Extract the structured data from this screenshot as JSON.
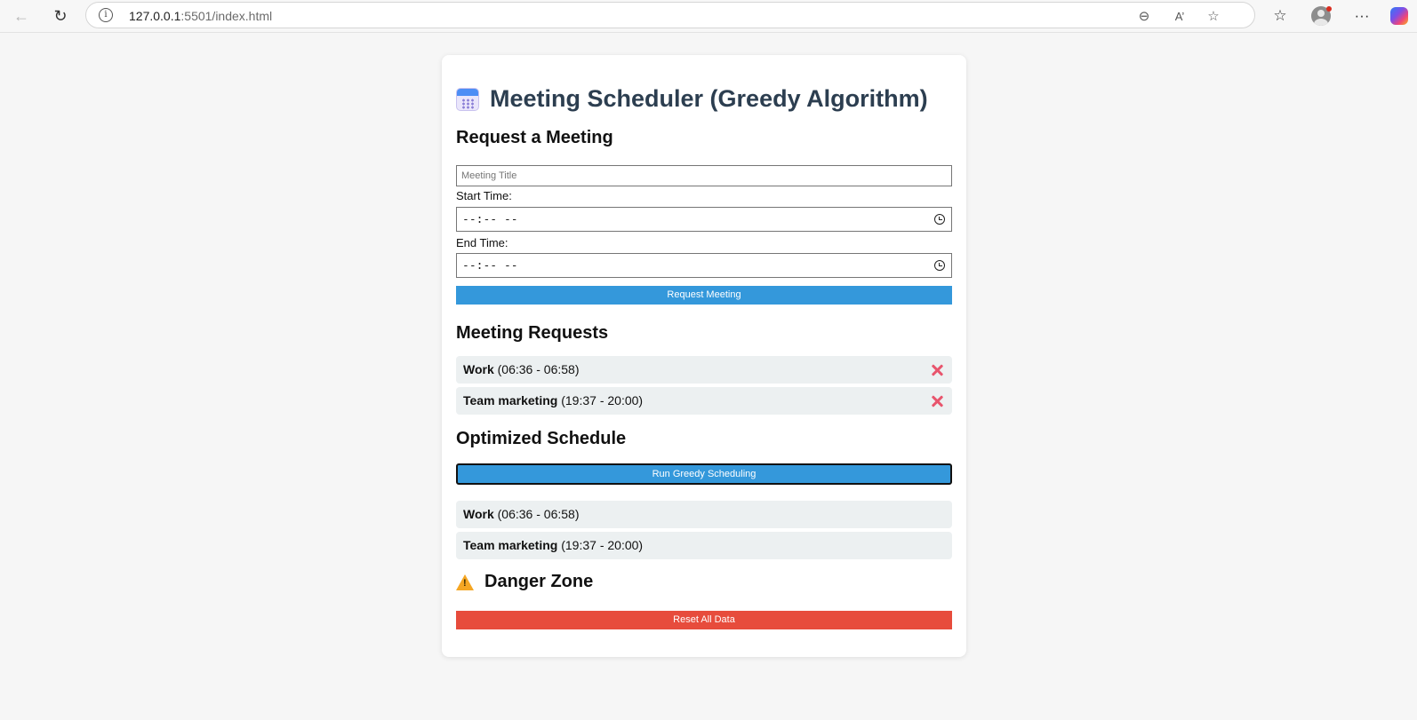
{
  "browser": {
    "url_host": "127.0.0.1",
    "url_rest": ":5501/index.html"
  },
  "app": {
    "title": "Meeting Scheduler (Greedy Algorithm)"
  },
  "request_section": {
    "heading": "Request a Meeting",
    "title_placeholder": "Meeting Title",
    "start_label": "Start Time:",
    "start_value": "--:-- --",
    "end_label": "End Time:",
    "end_value": "--:-- --",
    "submit_label": "Request Meeting"
  },
  "requests_section": {
    "heading": "Meeting Requests",
    "items": [
      {
        "name": "Work",
        "time": "(06:36 - 06:58)"
      },
      {
        "name": "Team marketing",
        "time": "(19:37 - 20:00)"
      }
    ]
  },
  "schedule_section": {
    "heading": "Optimized Schedule",
    "run_label": "Run Greedy Scheduling",
    "items": [
      {
        "name": "Work",
        "time": "(06:36 - 06:58)"
      },
      {
        "name": "Team marketing",
        "time": "(19:37 - 20:00)"
      }
    ]
  },
  "danger_section": {
    "heading": "Danger Zone",
    "reset_label": "Reset All Data"
  },
  "colors": {
    "primary": "#3498db",
    "danger": "#e74c3c",
    "title": "#2c3e50",
    "item_bg": "#ecf0f1",
    "delete_icon": "#e8556d"
  }
}
